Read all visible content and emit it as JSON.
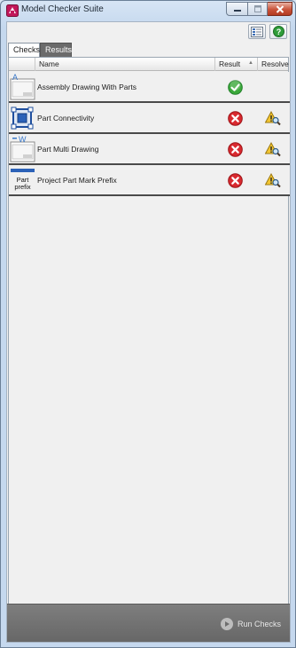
{
  "window": {
    "title": "Model Checker Suite",
    "controls": {
      "minimize_icon": "minimize-icon",
      "maximize_icon": "maximize-icon",
      "close_icon": "close-icon"
    }
  },
  "toolbar": {
    "buttons": [
      {
        "icon": "report-list-icon"
      },
      {
        "icon": "help-icon",
        "color": "#2f9d3a"
      }
    ]
  },
  "tabs": [
    {
      "label": "Checks",
      "active": true
    },
    {
      "label": "Results",
      "active": false
    }
  ],
  "grid": {
    "columns": [
      "",
      "Name",
      "Result",
      "Resolve"
    ],
    "sorted_column": "Result",
    "rows": [
      {
        "name": "Assembly Drawing With Parts",
        "thumb_icon": "assembly-drawing-icon",
        "thumb_text": "A",
        "result": "pass",
        "resolve": ""
      },
      {
        "name": "Part Connectivity",
        "thumb_icon": "part-connectivity-icon",
        "thumb_text": "",
        "result": "fail",
        "resolve": "warning-inspect"
      },
      {
        "name": "Part Multi Drawing",
        "thumb_icon": "part-multi-drawing-icon",
        "thumb_text": "W",
        "result": "fail",
        "resolve": "warning-inspect"
      },
      {
        "name": "Project Part Mark Prefix",
        "thumb_icon": "part-prefix-icon",
        "thumb_text": "Part prefix",
        "thumb_line1": "Part",
        "thumb_line2": "prefix",
        "result": "fail",
        "resolve": "warning-inspect"
      }
    ]
  },
  "footer": {
    "run_label": "Run Checks"
  },
  "colors": {
    "pass": "#3aa83a",
    "fail": "#d8292f",
    "warning": "#f2c531",
    "footer": "#707070",
    "results_tab": "#6b6b6b"
  }
}
